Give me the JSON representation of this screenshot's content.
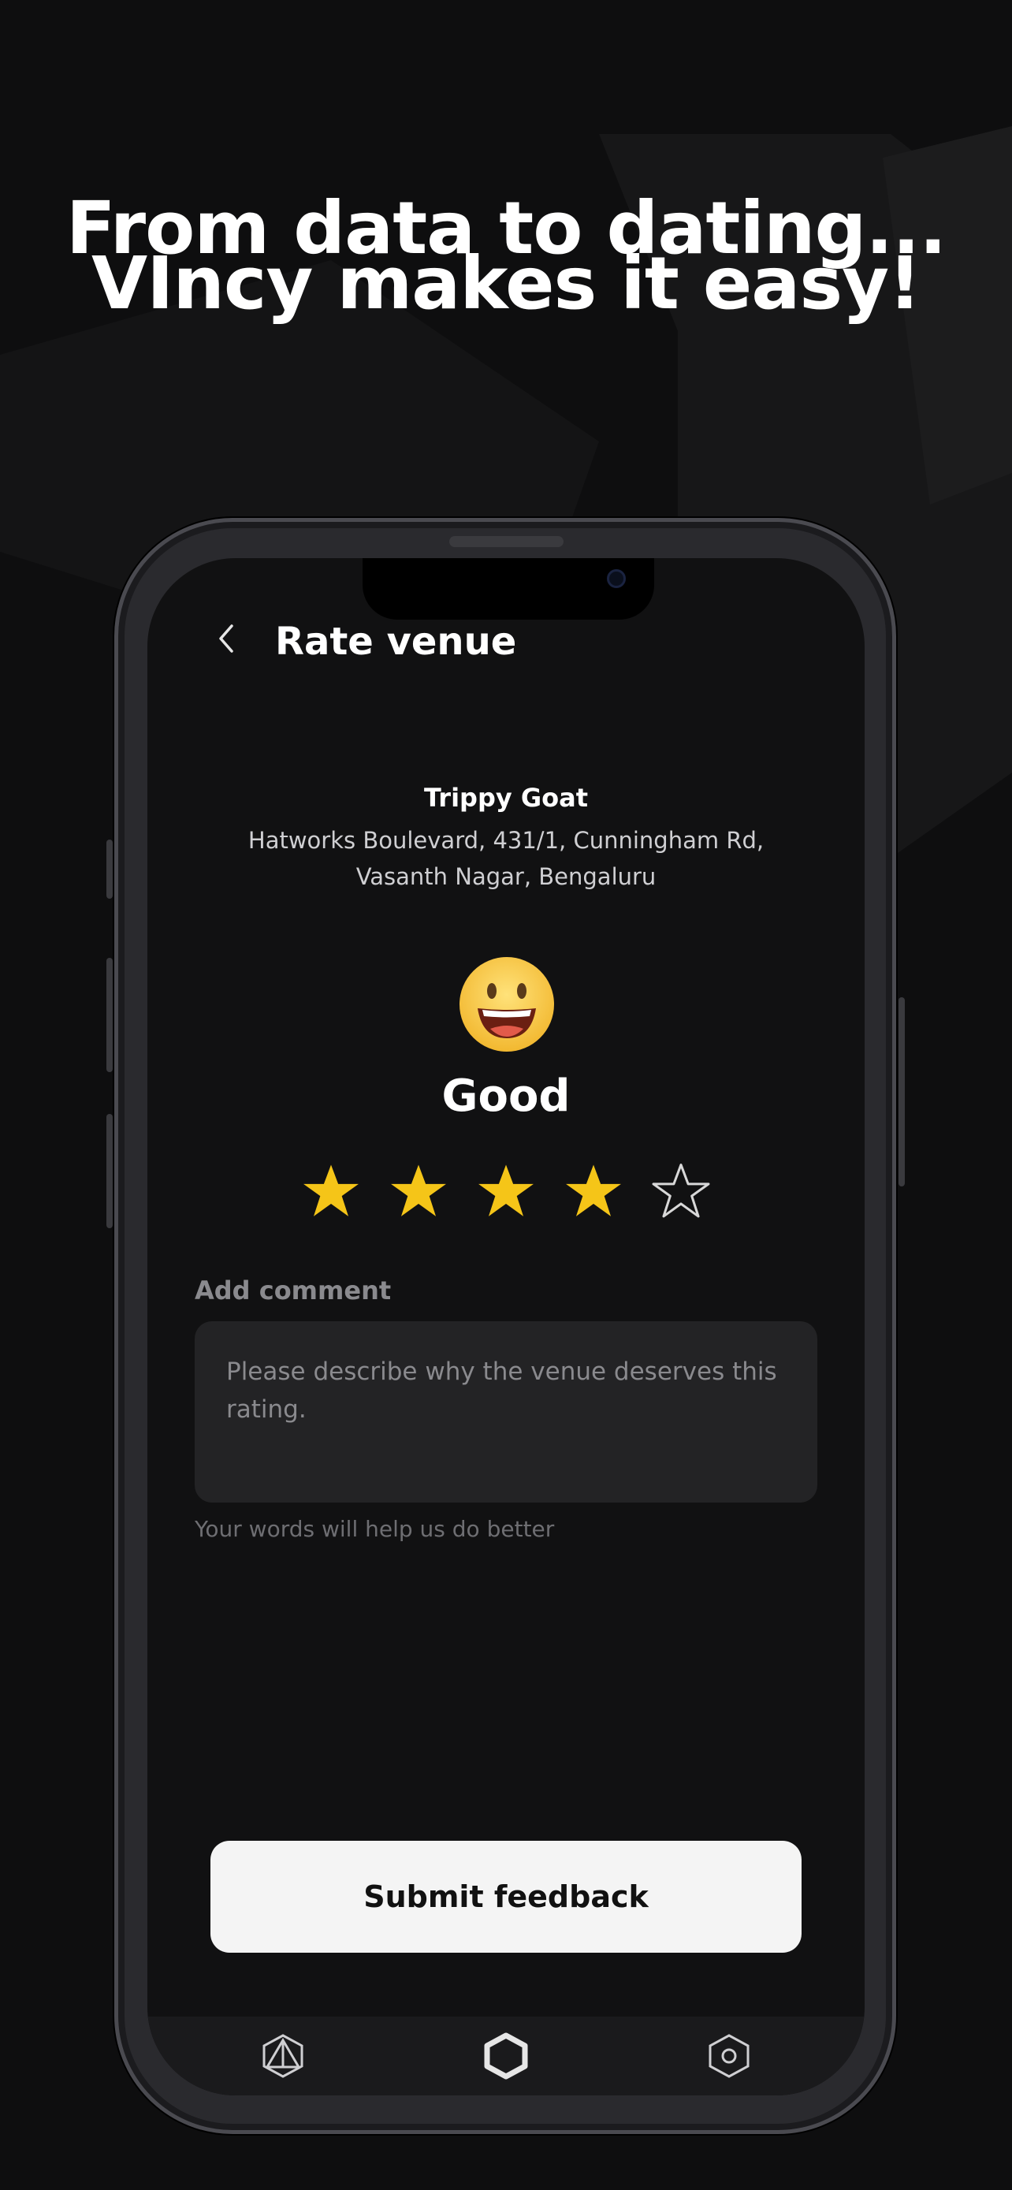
{
  "headline": {
    "line1": "From data to dating...",
    "line2": "VIncy makes it easy!"
  },
  "screen": {
    "title": "Rate venue",
    "back_icon": "chevron-left-icon"
  },
  "venue": {
    "name": "Trippy Goat",
    "address_line1": "Hatworks Boulevard, 431/1, Cunningham Rd,",
    "address_line2": "Vasanth Nagar, Bengaluru"
  },
  "rating": {
    "label": "Good",
    "value": 4,
    "max": 5,
    "emoji_icon": "grinning-face-icon",
    "filled_color": "#F5C518",
    "empty_color": "#d8d8d8"
  },
  "comment": {
    "label": "Add comment",
    "placeholder": "Please describe why the venue deserves this rating.",
    "helper": "Your words will help us do better"
  },
  "submit_label": "Submit feedback",
  "tabbar": {
    "items": [
      {
        "icon": "triangle-hex-icon"
      },
      {
        "icon": "hexagon-icon"
      },
      {
        "icon": "hexagon-dot-icon"
      }
    ]
  }
}
